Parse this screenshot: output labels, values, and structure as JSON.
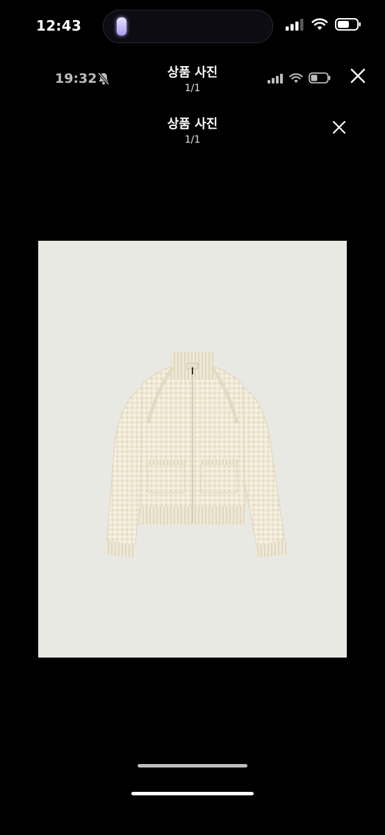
{
  "status_bar": {
    "time": "12:43"
  },
  "inner_status_bar": {
    "time": "19:32"
  },
  "viewer_header": {
    "title": "상품 사진",
    "counter": "1/1"
  },
  "viewer_header_2": {
    "title": "상품 사진",
    "counter": "1/1"
  },
  "photo": {
    "subject": "cream knit zip-up cardigan",
    "background_color": "#e9e9e4"
  },
  "icons": {
    "close": "close-icon",
    "signal": "cellular-signal-icon",
    "wifi": "wifi-icon",
    "battery": "battery-icon",
    "silent": "bell-slash-icon"
  }
}
